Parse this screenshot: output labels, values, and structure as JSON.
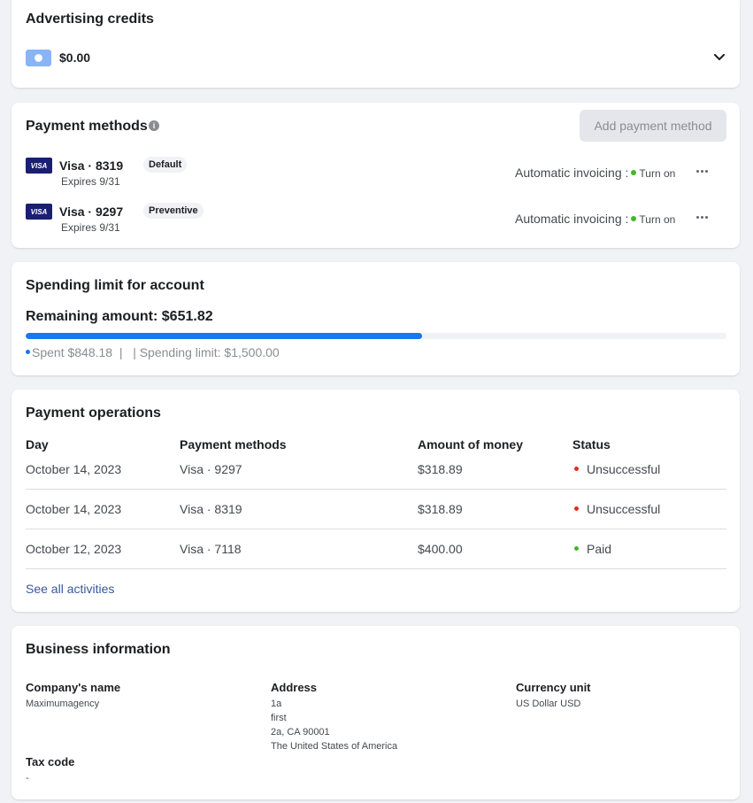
{
  "advertising_credits": {
    "title": "Advertising credits",
    "amount": "$0.00",
    "icon": "credit-icon"
  },
  "payment_methods": {
    "title": "Payment methods",
    "add_button": "Add payment method",
    "auto_invoicing_label": "Automatic invoicing :",
    "turn_on_label": "Turn on",
    "items": [
      {
        "brand": "VISA",
        "name": "Visa · 8319",
        "tag": "Default",
        "expires": "Expires 9/31"
      },
      {
        "brand": "VISA",
        "name": "Visa · 9297",
        "tag": "Preventive",
        "expires": "Expires 9/31"
      }
    ]
  },
  "spending_limit": {
    "title": "Spending limit for account",
    "remaining": "Remaining amount: $651.82",
    "spent_label": "Spent $848.18",
    "separator": "|",
    "limit_label": "| Spending limit: $1,500.00",
    "progress_fraction": 0.5654
  },
  "payment_operations": {
    "title": "Payment operations",
    "columns": [
      "Day",
      "Payment methods",
      "Amount of money",
      "Status"
    ],
    "rows": [
      {
        "day": "October 14, 2023",
        "method": "Visa · 9297",
        "amount": "$318.89",
        "status": "Unsuccessful",
        "status_color": "#e02c24"
      },
      {
        "day": "October 14, 2023",
        "method": "Visa · 8319",
        "amount": "$318.89",
        "status": "Unsuccessful",
        "status_color": "#e02c24"
      },
      {
        "day": "October 12, 2023",
        "method": "Visa · 7118",
        "amount": "$400.00",
        "status": "Paid",
        "status_color": "#42b72a"
      }
    ],
    "see_all": "See all activities"
  },
  "business_information": {
    "title": "Business information",
    "company_label": "Company's name",
    "company_value": "Maximumagency",
    "address_label": "Address",
    "address_lines": [
      "1a",
      "first",
      "2a, CA 90001",
      "The United States of America"
    ],
    "currency_label": "Currency unit",
    "currency_value": "US Dollar USD",
    "tax_label": "Tax code",
    "tax_value": "-"
  },
  "colors": {
    "accent": "#1877f2",
    "link": "#385898",
    "success": "#42b72a",
    "error": "#e02c24"
  }
}
